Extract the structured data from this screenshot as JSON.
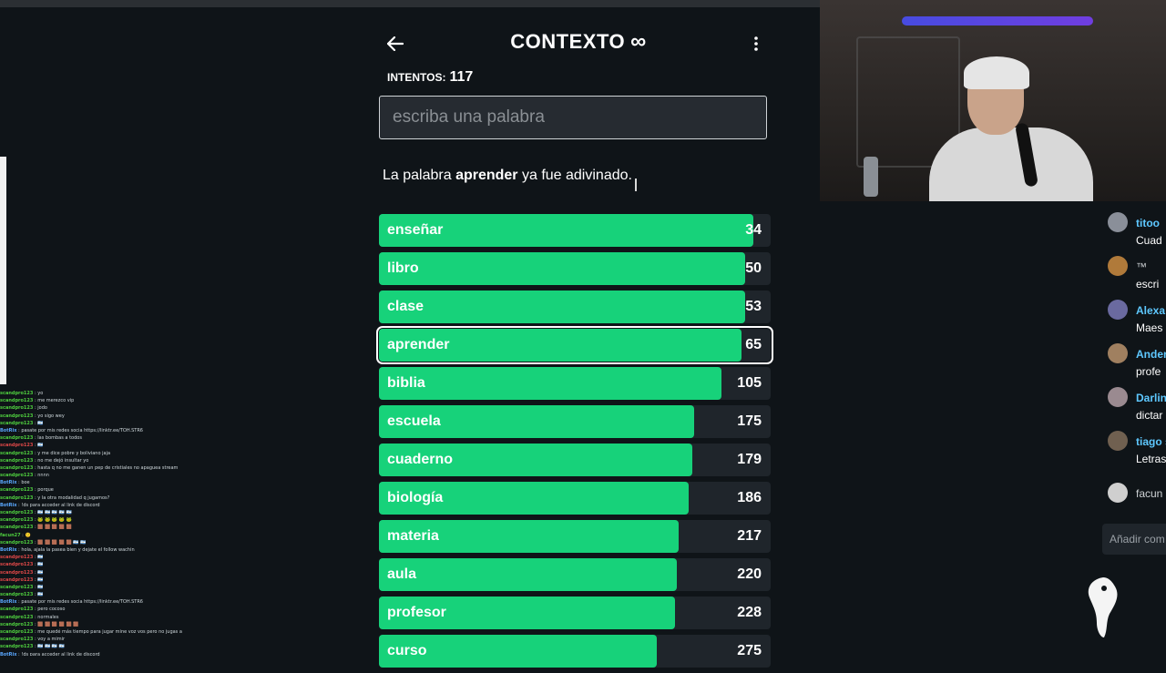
{
  "game": {
    "title": "CONTEXTO",
    "title_icon": "infinity-icon",
    "attempts_label": "INTENTOS:",
    "attempts_value": "117",
    "input_placeholder": "escriba una palabra",
    "input_value": "",
    "message_before": "La palabra ",
    "message_word": "aprender",
    "message_after": " ya fue adivinado.",
    "guesses": [
      {
        "word": "enseñar",
        "rank": "34",
        "fill": 0.955,
        "current": false
      },
      {
        "word": "libro",
        "rank": "50",
        "fill": 0.935,
        "current": false
      },
      {
        "word": "clase",
        "rank": "53",
        "fill": 0.935,
        "current": false
      },
      {
        "word": "aprender",
        "rank": "65",
        "fill": 0.925,
        "current": true
      },
      {
        "word": "biblia",
        "rank": "105",
        "fill": 0.875,
        "current": false
      },
      {
        "word": "escuela",
        "rank": "175",
        "fill": 0.805,
        "current": false
      },
      {
        "word": "cuaderno",
        "rank": "179",
        "fill": 0.8,
        "current": false
      },
      {
        "word": "biología",
        "rank": "186",
        "fill": 0.79,
        "current": false
      },
      {
        "word": "materia",
        "rank": "217",
        "fill": 0.765,
        "current": false
      },
      {
        "word": "aula",
        "rank": "220",
        "fill": 0.76,
        "current": false
      },
      {
        "word": "profesor",
        "rank": "228",
        "fill": 0.755,
        "current": false
      },
      {
        "word": "curso",
        "rank": "275",
        "fill": 0.71,
        "current": false
      }
    ],
    "colors": {
      "bar": "#17d27a",
      "background": "#0f1418",
      "track": "#1f252b"
    }
  },
  "overlay_chat": [
    {
      "user": "scandpro123",
      "text": "yo",
      "color": "green"
    },
    {
      "user": "scandpro123",
      "text": "me merezco vip",
      "color": "green"
    },
    {
      "user": "scandpro123",
      "text": "jodo",
      "color": "green"
    },
    {
      "user": "scandpro123",
      "text": "yo sigo wey",
      "color": "green"
    },
    {
      "user": "scandpro123",
      "text": "🇦🇷",
      "color": "green"
    },
    {
      "user": "BotRix",
      "text": "pasate por mis redes socia https://linktr.ee/TOH.STR6",
      "color": "blue"
    },
    {
      "user": "scandpro123",
      "text": "las bombas a todos",
      "color": "green"
    },
    {
      "user": "scandpro123",
      "text": "🇦🇷",
      "color": "red"
    },
    {
      "user": "scandpro123",
      "text": "y me dice pobre y boliviano jaja",
      "color": "green"
    },
    {
      "user": "scandpro123",
      "text": "no me dejó insultar yo",
      "color": "green"
    },
    {
      "user": "scandpro123",
      "text": "hasta q no me ganen un pep de cristiales no apaguea stream",
      "color": "green"
    },
    {
      "user": "scandpro123",
      "text": "nnnn",
      "color": "green"
    },
    {
      "user": "BotRix",
      "text": "boe",
      "color": "blue"
    },
    {
      "user": "scandpro123",
      "text": "porque",
      "color": "green"
    },
    {
      "user": "scandpro123",
      "text": "y la otra modalidad q jugamos?",
      "color": "green"
    },
    {
      "user": "BotRix",
      "text": "!ds para acceder al link de discord",
      "color": "blue"
    },
    {
      "user": "scandpro123",
      "text": "🇦🇷 🇦🇷 🇦🇷 🇦🇷 🇦🇷",
      "color": "green"
    },
    {
      "user": "scandpro123",
      "text": "🐸 🐸 🐸 🐸 🐸",
      "color": "green"
    },
    {
      "user": "scandpro123",
      "text": "🟫 🟫 🟫 🟫 🟫",
      "color": "green"
    },
    {
      "user": "facun27",
      "text": "🙂",
      "color": "green"
    },
    {
      "user": "scandpro123",
      "text": "🟫 🟫 🟫 🟫 🟫 🇦🇷 🇦🇷",
      "color": "green"
    },
    {
      "user": "BotRix",
      "text": "hola, ajala la pasea bien y dejate el follow wachin",
      "color": "blue"
    },
    {
      "user": "scandpro123",
      "text": "🇦🇷",
      "color": "red"
    },
    {
      "user": "scandpro123",
      "text": "🇦🇷",
      "color": "red"
    },
    {
      "user": "scandpro123",
      "text": "🇦🇷",
      "color": "red"
    },
    {
      "user": "scandpro123",
      "text": "🇦🇷",
      "color": "red"
    },
    {
      "user": "scandpro123",
      "text": "🇦🇷",
      "color": "green"
    },
    {
      "user": "scandpro123",
      "text": "🇦🇷",
      "color": "green"
    },
    {
      "user": "BotRix",
      "text": "pasate por mis redes socia https://linktr.ee/TOH.STR6",
      "color": "blue"
    },
    {
      "user": "scandpro123",
      "text": "pero cocoso",
      "color": "green"
    },
    {
      "user": "scandpro123",
      "text": "normales",
      "color": "green"
    },
    {
      "user": "scandpro123",
      "text": "🟫 🟫 🟫 🟫 🟫 🟫",
      "color": "green"
    },
    {
      "user": "scandpro123",
      "text": "me quedé más tiempo para jugar mine voz vos pero no jugas así q",
      "color": "green"
    },
    {
      "user": "scandpro123",
      "text": "voy a mimir",
      "color": "green"
    },
    {
      "user": "scandpro123",
      "text": "🇦🇷 🇦🇷 🇦🇷 🇦🇷",
      "color": "green"
    },
    {
      "user": "BotRix",
      "text": "!ds para acceder al link de discord",
      "color": "blue"
    }
  ],
  "right_chat": {
    "items": [
      {
        "name": "titoo",
        "text": "Cuad",
        "plain": false
      },
      {
        "name": "™",
        "text": "escri",
        "plain": true
      },
      {
        "name": "Alexa",
        "text": "Maes",
        "plain": false
      },
      {
        "name": "Ander",
        "text": "profe",
        "plain": false
      },
      {
        "name": "Darlin",
        "text": "dictar",
        "plain": false
      },
      {
        "name": "tiago s",
        "text": "Letras",
        "plain": false
      },
      {
        "name": "facun",
        "text": "",
        "plain": true
      }
    ],
    "input_placeholder": "Añadir com"
  }
}
